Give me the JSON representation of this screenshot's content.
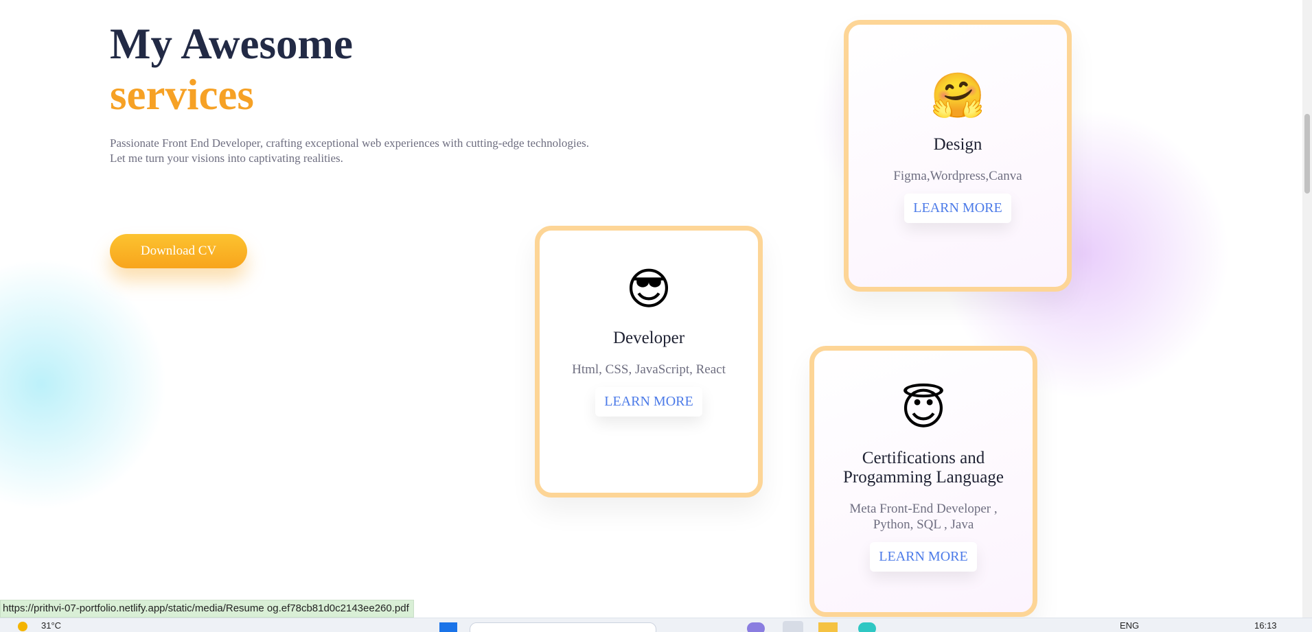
{
  "hero": {
    "title_line1": "My Awesome",
    "title_line2": "services",
    "description_line1": "Passionate Front End Developer, crafting exceptional web experiences with cutting-edge technologies.",
    "description_line2": "Let me turn your visions into captivating realities.",
    "cv_button_label": "Download CV"
  },
  "cards": {
    "design": {
      "emoji": "🤗",
      "title": "Design",
      "subtitle": "Figma,Wordpress,Canva",
      "button": "LEARN MORE"
    },
    "developer": {
      "emoji": "😎",
      "title": "Developer",
      "subtitle": "Html, CSS, JavaScript, React",
      "button": "LEARN MORE"
    },
    "certifications": {
      "emoji": "😇",
      "title_line1": "Certifications and",
      "title_line2": "Progamming Language",
      "subtitle_line1": "Meta Front-End Developer ,",
      "subtitle_line2": "Python, SQL , Java",
      "button": "LEARN MORE"
    }
  },
  "status_bar": {
    "url": "https://prithvi-07-portfolio.netlify.app/static/media/Resume og.ef78cb81d0c2143ee260.pdf"
  },
  "taskbar": {
    "weather": "31°C",
    "language": "ENG",
    "time": "16:13"
  },
  "colors": {
    "title_dark": "#222a45",
    "accent_orange": "#f6a125",
    "card_border": "#fdd596",
    "link_blue": "#4b7ae8"
  }
}
